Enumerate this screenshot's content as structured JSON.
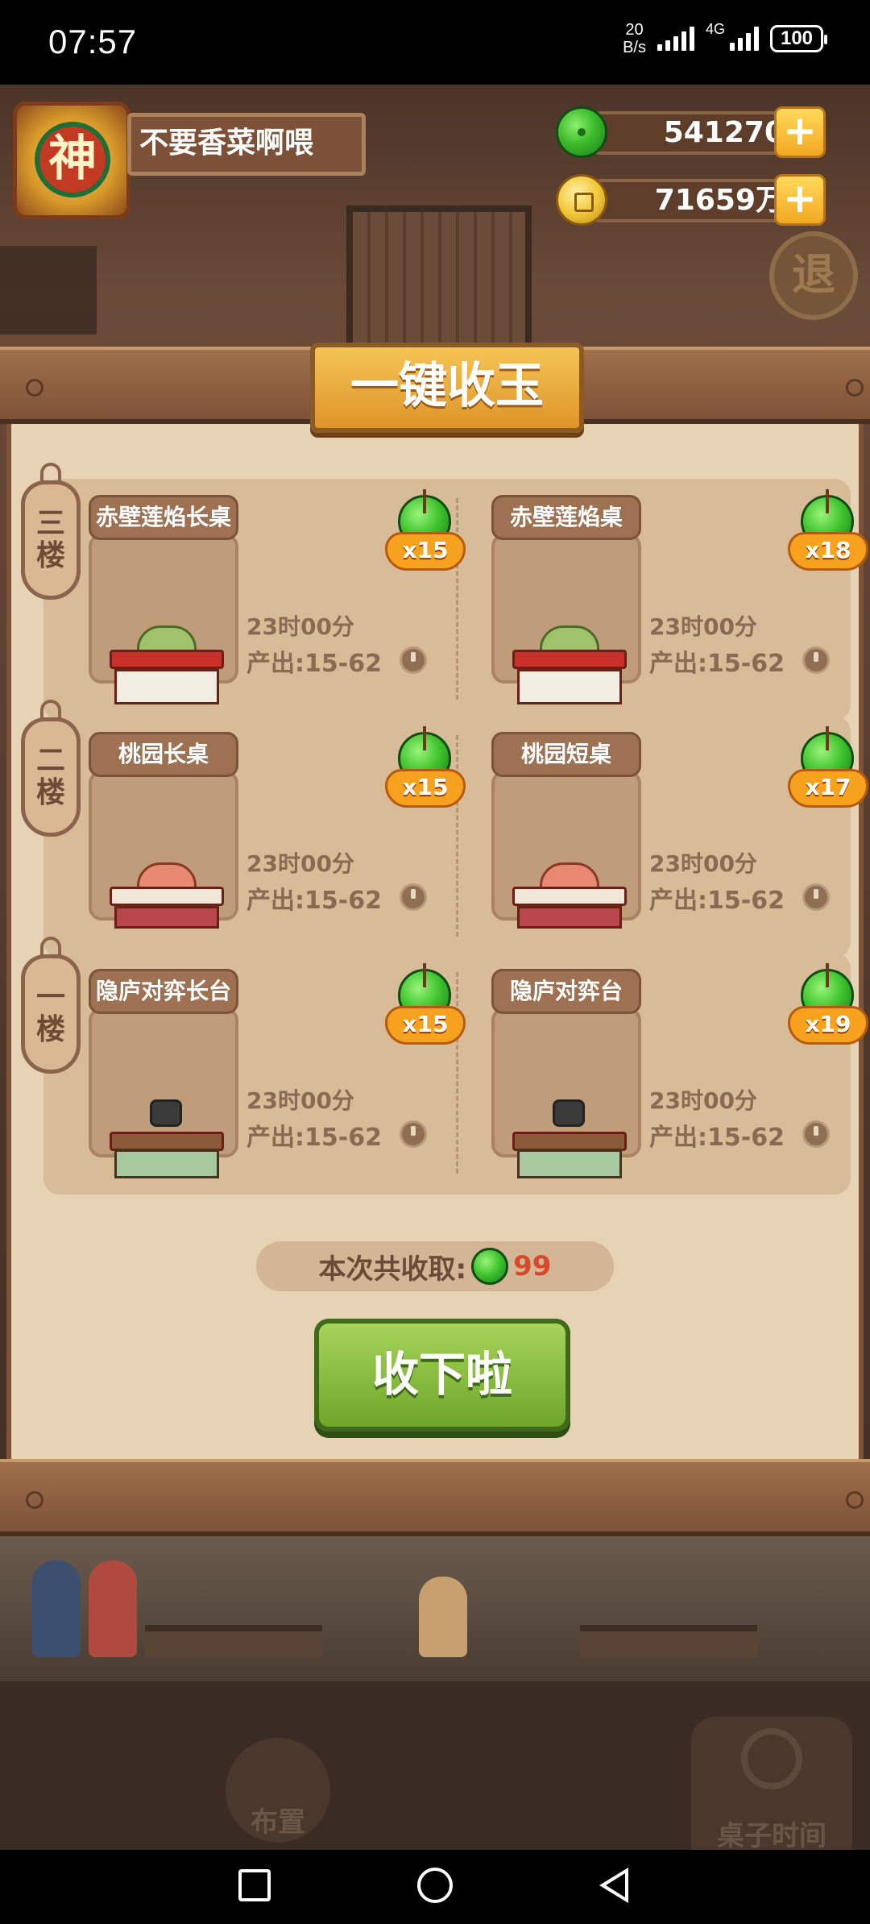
{
  "status_bar": {
    "time": "07:57",
    "net_speed_value": "20",
    "net_speed_unit": "B/s",
    "network_type": "4G",
    "battery": "100"
  },
  "header": {
    "avatar_glyph": "神",
    "player_name": "不要香菜啊喂",
    "jade_amount": "541270",
    "coin_amount": "71659万",
    "retreat_label": "退"
  },
  "panel": {
    "title": "一键收玉",
    "floors": [
      {
        "floor_label": "三楼",
        "tables": [
          {
            "name": "赤壁莲焰长桌",
            "multiplier": "x15",
            "time": "23时00分",
            "output": "产出:15-62"
          },
          {
            "name": "赤壁莲焰桌",
            "multiplier": "x18",
            "time": "23时00分",
            "output": "产出:15-62"
          }
        ]
      },
      {
        "floor_label": "二楼",
        "tables": [
          {
            "name": "桃园长桌",
            "multiplier": "x15",
            "time": "23时00分",
            "output": "产出:15-62"
          },
          {
            "name": "桃园短桌",
            "multiplier": "x17",
            "time": "23时00分",
            "output": "产出:15-62"
          }
        ]
      },
      {
        "floor_label": "一楼",
        "tables": [
          {
            "name": "隐庐对弈长台",
            "multiplier": "x15",
            "time": "23时00分",
            "output": "产出:15-62"
          },
          {
            "name": "隐庐对弈台",
            "multiplier": "x19",
            "time": "23时00分",
            "output": "产出:15-62"
          }
        ]
      }
    ],
    "summary_label": "本次共收取:",
    "summary_value": "99",
    "collect_button": "收下啦"
  },
  "bottom": {
    "layout_label": "布置",
    "table_time_label": "桌子时间"
  },
  "colors": {
    "panel_bg": "#e6d2b4",
    "jade_green": "#3cc12c",
    "gold": "#f2a822",
    "button_green": "#6ea62a",
    "highlight_red": "#d44a2a"
  }
}
